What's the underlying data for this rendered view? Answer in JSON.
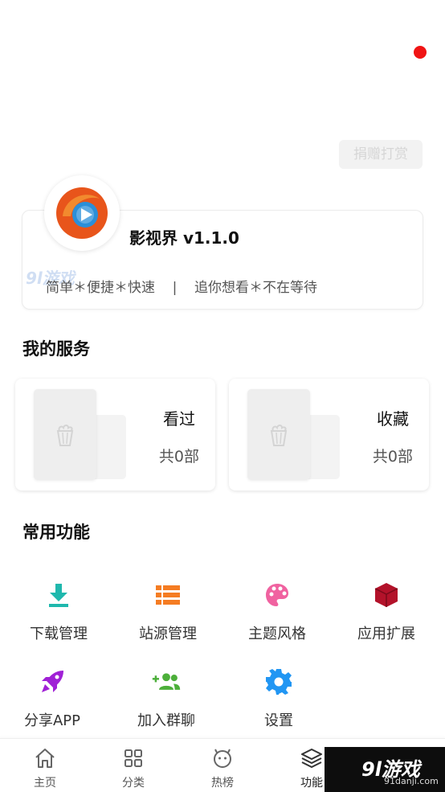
{
  "header": {
    "donate_label": "捐赠打赏"
  },
  "profile": {
    "app_name": "影视界 v1.1.0",
    "slogan": "简单＊便捷＊快速    |    追你想看＊不在等待",
    "watermark": "9l游戏"
  },
  "services": {
    "title": "我的服务",
    "items": [
      {
        "label": "看过",
        "count": "共0部"
      },
      {
        "label": "收藏",
        "count": "共0部"
      }
    ]
  },
  "functions": {
    "title": "常用功能",
    "items": [
      {
        "label": "下载管理",
        "icon": "download-icon",
        "color": "#1fb8ad"
      },
      {
        "label": "站源管理",
        "icon": "list-icon",
        "color": "#f57c22"
      },
      {
        "label": "主题风格",
        "icon": "palette-icon",
        "color": "#f062a0"
      },
      {
        "label": "应用扩展",
        "icon": "cube-icon",
        "color": "#b3122a"
      },
      {
        "label": "分享APP",
        "icon": "rocket-icon",
        "color": "#a020d6"
      },
      {
        "label": "加入群聊",
        "icon": "group-add-icon",
        "color": "#4caf3a"
      },
      {
        "label": "设置",
        "icon": "gear-icon",
        "color": "#2196f3"
      }
    ]
  },
  "bottom_nav": {
    "items": [
      {
        "label": "主页",
        "icon": "home-icon"
      },
      {
        "label": "分类",
        "icon": "grid-icon"
      },
      {
        "label": "热榜",
        "icon": "smile-icon"
      },
      {
        "label": "功能",
        "icon": "layers-icon"
      }
    ]
  },
  "brand": {
    "logo": "9l游戏",
    "url": "91danji.com"
  }
}
